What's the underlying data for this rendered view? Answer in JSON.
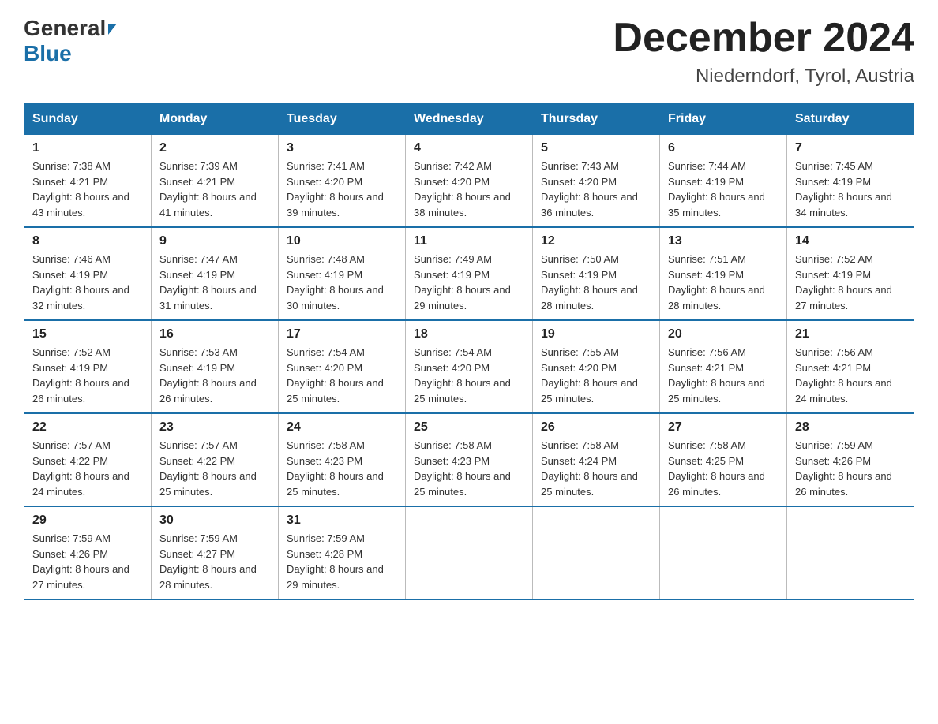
{
  "header": {
    "logo_general": "General",
    "logo_blue": "Blue",
    "month_year": "December 2024",
    "location": "Niederndorf, Tyrol, Austria"
  },
  "weekdays": [
    "Sunday",
    "Monday",
    "Tuesday",
    "Wednesday",
    "Thursday",
    "Friday",
    "Saturday"
  ],
  "weeks": [
    [
      {
        "day": "1",
        "sunrise": "7:38 AM",
        "sunset": "4:21 PM",
        "daylight": "8 hours and 43 minutes."
      },
      {
        "day": "2",
        "sunrise": "7:39 AM",
        "sunset": "4:21 PM",
        "daylight": "8 hours and 41 minutes."
      },
      {
        "day": "3",
        "sunrise": "7:41 AM",
        "sunset": "4:20 PM",
        "daylight": "8 hours and 39 minutes."
      },
      {
        "day": "4",
        "sunrise": "7:42 AM",
        "sunset": "4:20 PM",
        "daylight": "8 hours and 38 minutes."
      },
      {
        "day": "5",
        "sunrise": "7:43 AM",
        "sunset": "4:20 PM",
        "daylight": "8 hours and 36 minutes."
      },
      {
        "day": "6",
        "sunrise": "7:44 AM",
        "sunset": "4:19 PM",
        "daylight": "8 hours and 35 minutes."
      },
      {
        "day": "7",
        "sunrise": "7:45 AM",
        "sunset": "4:19 PM",
        "daylight": "8 hours and 34 minutes."
      }
    ],
    [
      {
        "day": "8",
        "sunrise": "7:46 AM",
        "sunset": "4:19 PM",
        "daylight": "8 hours and 32 minutes."
      },
      {
        "day": "9",
        "sunrise": "7:47 AM",
        "sunset": "4:19 PM",
        "daylight": "8 hours and 31 minutes."
      },
      {
        "day": "10",
        "sunrise": "7:48 AM",
        "sunset": "4:19 PM",
        "daylight": "8 hours and 30 minutes."
      },
      {
        "day": "11",
        "sunrise": "7:49 AM",
        "sunset": "4:19 PM",
        "daylight": "8 hours and 29 minutes."
      },
      {
        "day": "12",
        "sunrise": "7:50 AM",
        "sunset": "4:19 PM",
        "daylight": "8 hours and 28 minutes."
      },
      {
        "day": "13",
        "sunrise": "7:51 AM",
        "sunset": "4:19 PM",
        "daylight": "8 hours and 28 minutes."
      },
      {
        "day": "14",
        "sunrise": "7:52 AM",
        "sunset": "4:19 PM",
        "daylight": "8 hours and 27 minutes."
      }
    ],
    [
      {
        "day": "15",
        "sunrise": "7:52 AM",
        "sunset": "4:19 PM",
        "daylight": "8 hours and 26 minutes."
      },
      {
        "day": "16",
        "sunrise": "7:53 AM",
        "sunset": "4:19 PM",
        "daylight": "8 hours and 26 minutes."
      },
      {
        "day": "17",
        "sunrise": "7:54 AM",
        "sunset": "4:20 PM",
        "daylight": "8 hours and 25 minutes."
      },
      {
        "day": "18",
        "sunrise": "7:54 AM",
        "sunset": "4:20 PM",
        "daylight": "8 hours and 25 minutes."
      },
      {
        "day": "19",
        "sunrise": "7:55 AM",
        "sunset": "4:20 PM",
        "daylight": "8 hours and 25 minutes."
      },
      {
        "day": "20",
        "sunrise": "7:56 AM",
        "sunset": "4:21 PM",
        "daylight": "8 hours and 25 minutes."
      },
      {
        "day": "21",
        "sunrise": "7:56 AM",
        "sunset": "4:21 PM",
        "daylight": "8 hours and 24 minutes."
      }
    ],
    [
      {
        "day": "22",
        "sunrise": "7:57 AM",
        "sunset": "4:22 PM",
        "daylight": "8 hours and 24 minutes."
      },
      {
        "day": "23",
        "sunrise": "7:57 AM",
        "sunset": "4:22 PM",
        "daylight": "8 hours and 25 minutes."
      },
      {
        "day": "24",
        "sunrise": "7:58 AM",
        "sunset": "4:23 PM",
        "daylight": "8 hours and 25 minutes."
      },
      {
        "day": "25",
        "sunrise": "7:58 AM",
        "sunset": "4:23 PM",
        "daylight": "8 hours and 25 minutes."
      },
      {
        "day": "26",
        "sunrise": "7:58 AM",
        "sunset": "4:24 PM",
        "daylight": "8 hours and 25 minutes."
      },
      {
        "day": "27",
        "sunrise": "7:58 AM",
        "sunset": "4:25 PM",
        "daylight": "8 hours and 26 minutes."
      },
      {
        "day": "28",
        "sunrise": "7:59 AM",
        "sunset": "4:26 PM",
        "daylight": "8 hours and 26 minutes."
      }
    ],
    [
      {
        "day": "29",
        "sunrise": "7:59 AM",
        "sunset": "4:26 PM",
        "daylight": "8 hours and 27 minutes."
      },
      {
        "day": "30",
        "sunrise": "7:59 AM",
        "sunset": "4:27 PM",
        "daylight": "8 hours and 28 minutes."
      },
      {
        "day": "31",
        "sunrise": "7:59 AM",
        "sunset": "4:28 PM",
        "daylight": "8 hours and 29 minutes."
      },
      null,
      null,
      null,
      null
    ]
  ]
}
